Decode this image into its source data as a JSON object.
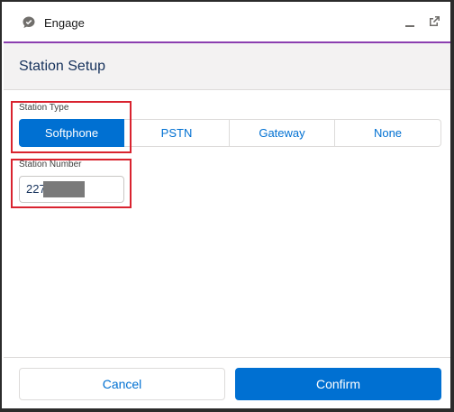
{
  "window": {
    "title": "Engage",
    "app_icon": "chat-bubble-check-icon",
    "minimize_icon": "minimize-icon",
    "popout_icon": "popout-icon"
  },
  "header": {
    "title": "Station Setup"
  },
  "station_type": {
    "label": "Station Type",
    "options": [
      "Softphone",
      "PSTN",
      "Gateway",
      "None"
    ],
    "selected": "Softphone"
  },
  "station_number": {
    "label": "Station Number",
    "value": "227"
  },
  "footer": {
    "cancel_label": "Cancel",
    "confirm_label": "Confirm"
  },
  "colors": {
    "accent": "#0070d2",
    "titlebar_border": "#8b3fb0",
    "highlight": "#d9232f"
  }
}
